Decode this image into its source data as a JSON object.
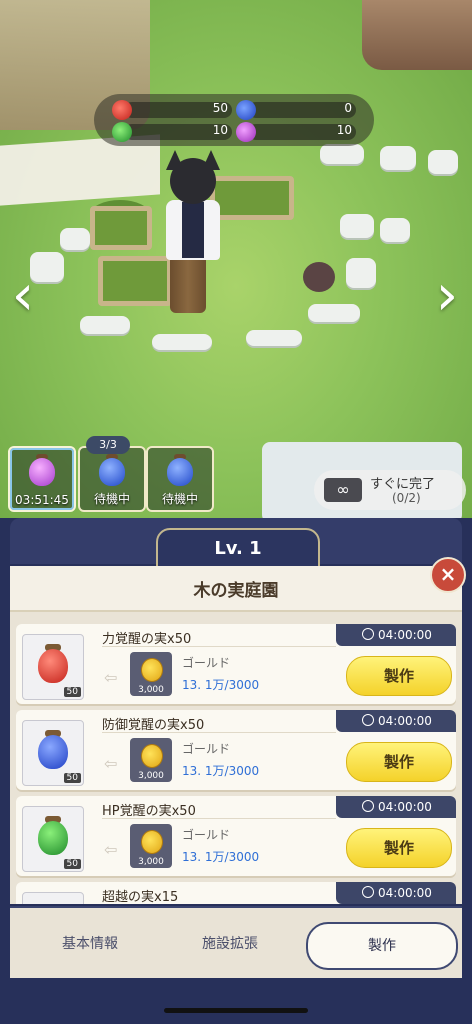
{
  "resources": [
    {
      "color": "red",
      "value": "50"
    },
    {
      "color": "blue",
      "value": "0"
    },
    {
      "color": "green",
      "value": "10"
    },
    {
      "color": "purple",
      "value": "10"
    }
  ],
  "queue": {
    "count": "3/3",
    "slots": [
      {
        "fruit": "purple",
        "label": "03:51:45"
      },
      {
        "fruit": "blue",
        "label": "待機中"
      },
      {
        "fruit": "blue",
        "label": "待機中"
      }
    ]
  },
  "instant_complete": {
    "label": "すぐに完了",
    "count": "(0/2)"
  },
  "panel": {
    "level": "Lv. 1",
    "title": "木の実庭園"
  },
  "items": [
    {
      "name": "力覚醒の実x50",
      "qty": "50",
      "fruit_color": "#d93a2b",
      "time": "04:00:00",
      "cost_name": "ゴールド",
      "cost_qty": "3,000",
      "cost_val": "13. 1万/3000",
      "button": "製作"
    },
    {
      "name": "防御覚醒の実x50",
      "qty": "50",
      "fruit_color": "#2a4fd0",
      "time": "04:00:00",
      "cost_name": "ゴールド",
      "cost_qty": "3,000",
      "cost_val": "13. 1万/3000",
      "button": "製作"
    },
    {
      "name": "HP覚醒の実x50",
      "qty": "50",
      "fruit_color": "#2fa23a",
      "time": "04:00:00",
      "cost_name": "ゴールド",
      "cost_qty": "3,000",
      "cost_val": "13. 1万/3000",
      "button": "製作"
    },
    {
      "name": "超越の実x15",
      "time": "04:00:00"
    }
  ],
  "tabs": {
    "info": "基本情報",
    "expand": "施設拡張",
    "craft": "製作"
  }
}
